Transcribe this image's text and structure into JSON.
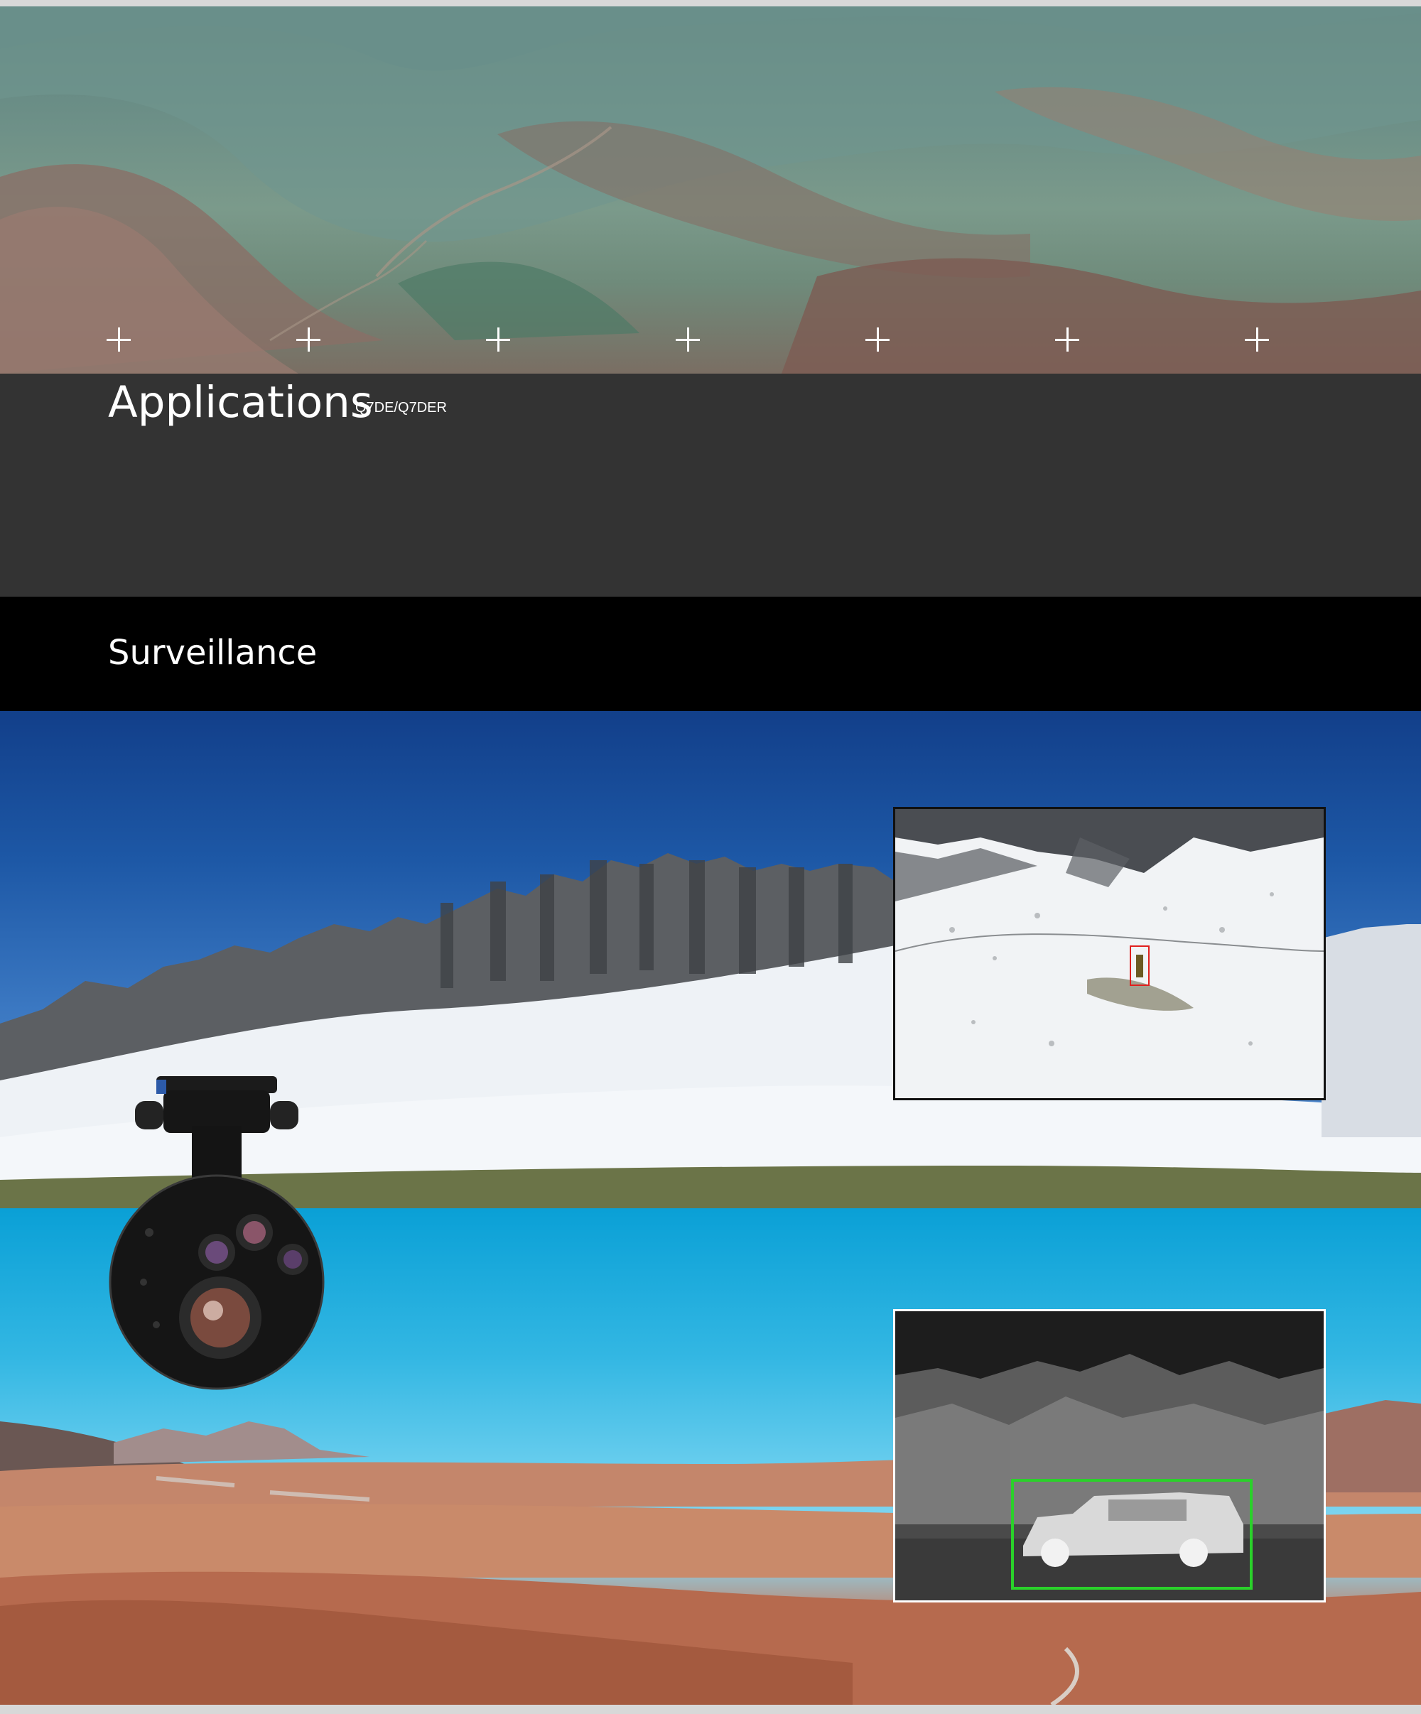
{
  "applications": {
    "title": "Applications",
    "subtitle": "Q7DE/Q7DER"
  },
  "surveillance": {
    "title": "Surveillance"
  },
  "hero": {
    "markers": [
      "plus-icon",
      "plus-icon",
      "plus-icon",
      "plus-icon",
      "plus-icon",
      "plus-icon",
      "plus-icon"
    ]
  },
  "colors": {
    "dark_band": "#333333",
    "black_band": "#000000",
    "detection_red": "#e0201e",
    "detection_green": "#2ad12a"
  },
  "icons": [
    "plus-icon",
    "gimbal-camera-icon"
  ]
}
